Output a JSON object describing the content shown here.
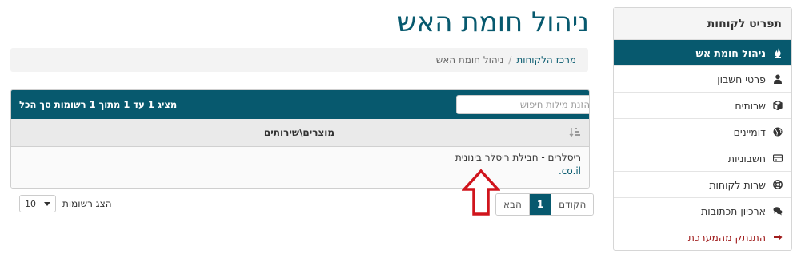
{
  "sidebar": {
    "title": "תפריט לקוחות",
    "items": [
      {
        "label": "ניהול חומת אש",
        "icon": "fire-icon"
      },
      {
        "label": "פרטי חשבון",
        "icon": "user-icon"
      },
      {
        "label": "שרותים",
        "icon": "cube-icon"
      },
      {
        "label": "דומיינים",
        "icon": "globe-icon"
      },
      {
        "label": "חשבוניות",
        "icon": "credit-card-icon"
      },
      {
        "label": "שרות לקוחות",
        "icon": "life-ring-icon"
      },
      {
        "label": "ארכיון תכתובות",
        "icon": "comments-icon"
      },
      {
        "label": "התנתק מהמערכת",
        "icon": "arrow-right-icon"
      }
    ]
  },
  "page": {
    "title": "ניהול חומת האש"
  },
  "breadcrumb": {
    "home": "מרכז הלקוחות",
    "separator": "/",
    "current": "ניהול חומת האש"
  },
  "panel": {
    "search_placeholder": "הזנת מילות חיפוש",
    "summary": "מציג 1 עד 1 מתוך 1 רשומות סך הכל",
    "column_header": "מוצרים\\שירותים",
    "row": {
      "product": "ריסלרים - חבילת ריסלר בינונית",
      "domain": ".co.il"
    }
  },
  "pagination": {
    "prev": "הקודם",
    "page": "1",
    "next": "הבא"
  },
  "page_length": {
    "label": "הצג רשומות",
    "value": "10"
  },
  "colors": {
    "primary": "#07596e",
    "logout": "#a01c1c",
    "annotation_arrow": "#d0141c"
  }
}
